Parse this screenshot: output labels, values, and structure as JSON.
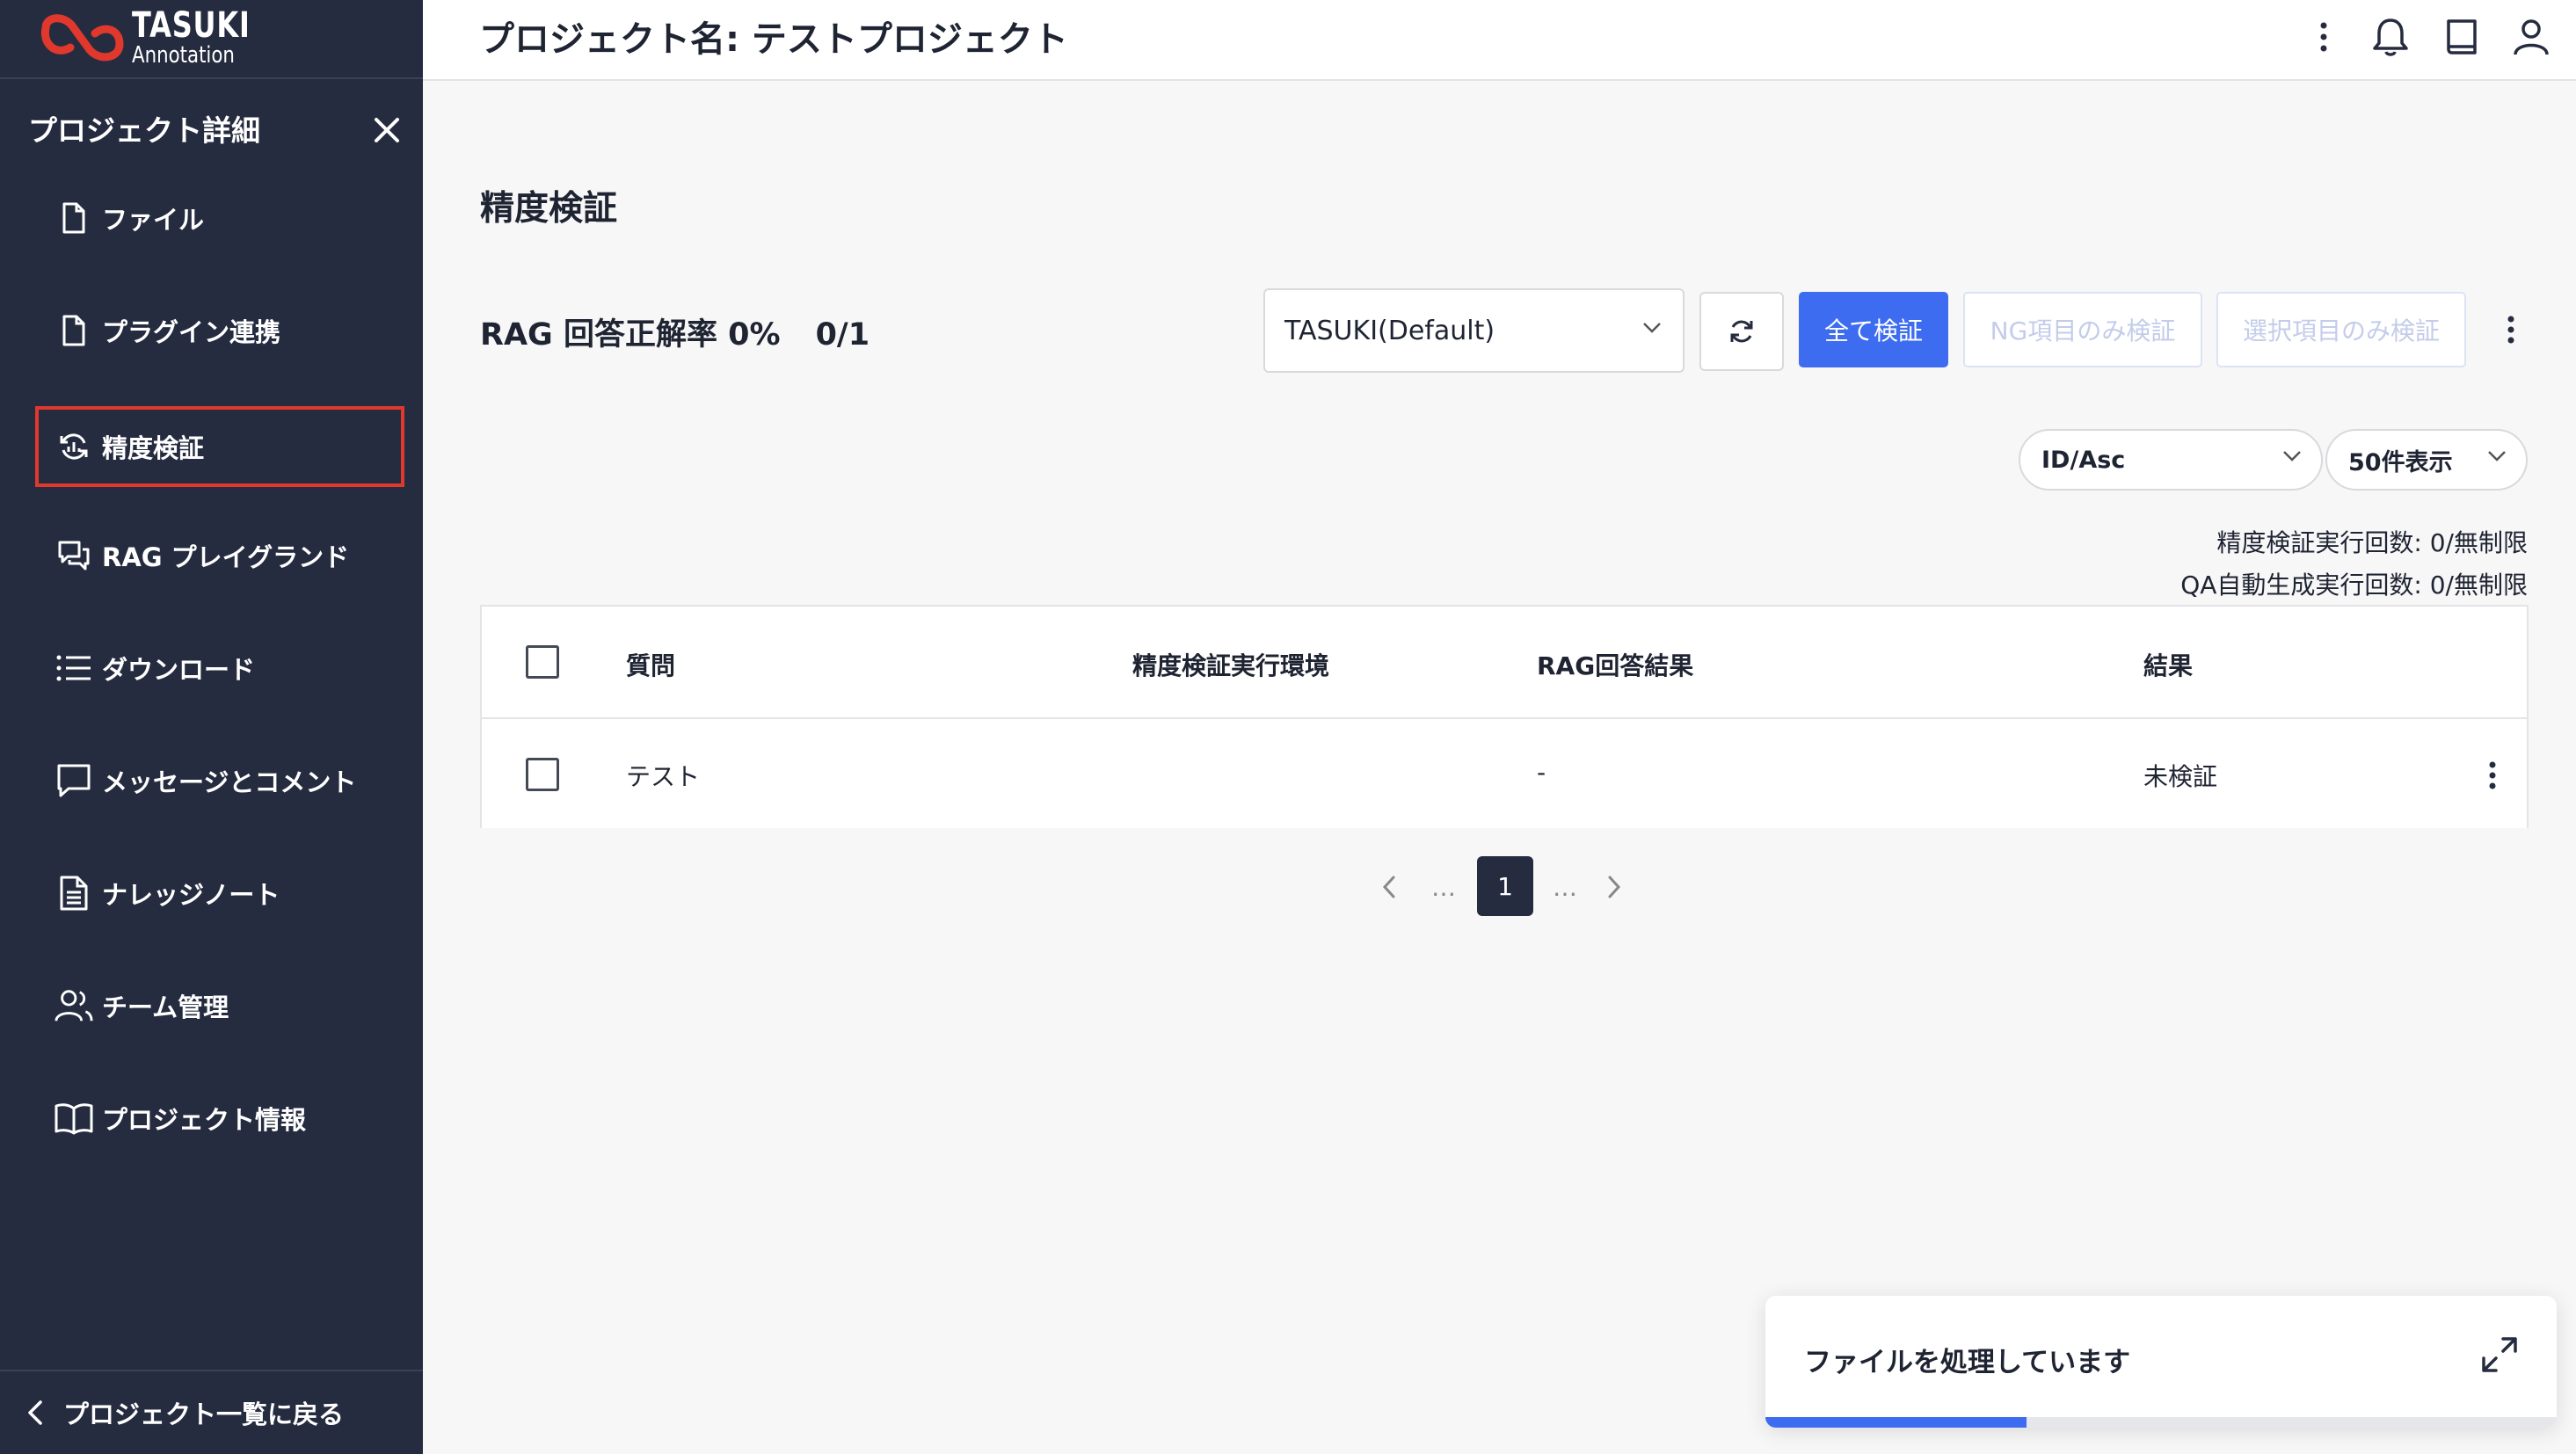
{
  "app": {
    "logo_title": "TASUKI",
    "logo_subtitle": "Annotation",
    "brand_color": "#e0382c",
    "accent_color": "#3d6cf0"
  },
  "sidebar": {
    "header": "プロジェクト詳細",
    "items": [
      {
        "label": "ファイル",
        "icon": "file-icon"
      },
      {
        "label": "プラグイン連携",
        "icon": "file-icon"
      },
      {
        "label": "精度検証",
        "icon": "refresh-chart-icon",
        "active": true
      },
      {
        "label": "RAG プレイグランド",
        "icon": "chat-icon"
      },
      {
        "label": "ダウンロード",
        "icon": "list-icon"
      },
      {
        "label": "メッセージとコメント",
        "icon": "message-icon"
      },
      {
        "label": "ナレッジノート",
        "icon": "document-icon"
      },
      {
        "label": "チーム管理",
        "icon": "team-icon"
      },
      {
        "label": "プロジェクト情報",
        "icon": "book-icon"
      }
    ],
    "footer_label": "プロジェクト一覧に戻る"
  },
  "header": {
    "project_title": "プロジェクト名: テストプロジェクト"
  },
  "main": {
    "page_title": "精度検証",
    "rag_rate_label": "RAG 回答正解率 0%",
    "rag_rate_fraction": "0/1",
    "model_select_value": "TASUKI(Default)",
    "verify_all_label": "全て検証",
    "verify_ng_label": "NG項目のみ検証",
    "verify_selected_label": "選択項目のみ検証",
    "sort_value": "ID/Asc",
    "page_size_value": "50件表示",
    "quota_verify": "精度検証実行回数: 0/無制限",
    "quota_qa": "QA自動生成実行回数: 0/無制限"
  },
  "table": {
    "headers": [
      "質問",
      "精度検証実行環境",
      "RAG回答結果",
      "結果"
    ],
    "rows": [
      {
        "question": "テスト",
        "environment": "",
        "rag_result": "-",
        "result": "未検証"
      }
    ]
  },
  "pagination": {
    "ellipsis_left": "…",
    "current_page": "1",
    "ellipsis_right": "…"
  },
  "toast": {
    "text": "ファイルを処理しています",
    "progress": 0.33
  }
}
